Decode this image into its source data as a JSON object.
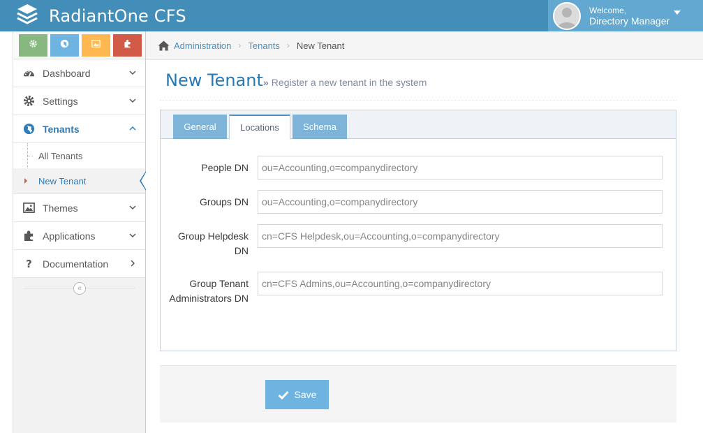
{
  "app": {
    "title": "RadiantOne CFS",
    "brand_color": "#438eb9",
    "user_box_color": "#62a8d1"
  },
  "user": {
    "welcome": "Welcome,",
    "name": "Directory Manager"
  },
  "shortcuts": [
    {
      "icon": "gear-icon",
      "color": "#87b87f"
    },
    {
      "icon": "globe-icon",
      "color": "#6fb3e0"
    },
    {
      "icon": "picture-icon",
      "color": "#ffb752"
    },
    {
      "icon": "puzzle-icon",
      "color": "#d15b47"
    }
  ],
  "sidebar": {
    "items": [
      {
        "label": "Dashboard",
        "icon": "dashboard-icon"
      },
      {
        "label": "Settings",
        "icon": "gear-icon"
      },
      {
        "label": "Tenants",
        "icon": "globe-icon",
        "active": true
      },
      {
        "label": "Themes",
        "icon": "picture-icon"
      },
      {
        "label": "Applications",
        "icon": "puzzle-icon"
      },
      {
        "label": "Documentation",
        "icon": "question-icon"
      }
    ],
    "submenu": [
      {
        "label": "All Tenants"
      },
      {
        "label": "New Tenant",
        "current": true
      }
    ]
  },
  "breadcrumb": {
    "items": [
      "Administration",
      "Tenants"
    ],
    "current": "New Tenant"
  },
  "page": {
    "title": "New Tenant",
    "subtitle": "Register a new tenant in the system"
  },
  "tabs": [
    {
      "label": "General"
    },
    {
      "label": "Locations",
      "active": true
    },
    {
      "label": "Schema"
    }
  ],
  "form": {
    "fields": [
      {
        "label": "People DN",
        "value": "ou=Accounting,o=companydirectory"
      },
      {
        "label": "Groups DN",
        "value": "ou=Accounting,o=companydirectory"
      },
      {
        "label": "Group Helpdesk DN",
        "value": "cn=CFS Helpdesk,ou=Accounting,o=companydirectory"
      },
      {
        "label": "Group Tenant Administrators DN",
        "value": "cn=CFS Admins,ou=Accounting,o=companydirectory"
      }
    ],
    "save_label": "Save"
  }
}
